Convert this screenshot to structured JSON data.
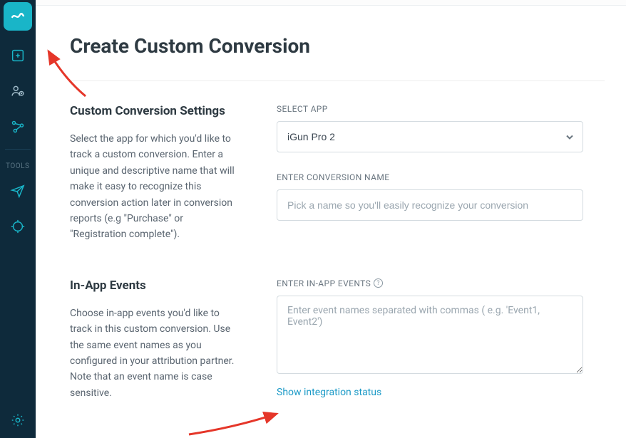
{
  "sidebar": {
    "tools_label": "TOOLS"
  },
  "page": {
    "title": "Create Custom Conversion"
  },
  "section_settings": {
    "heading": "Custom Conversion Settings",
    "description": "Select the app for which you'd like to track a custom conversion. Enter a unique and descriptive name that will make it easy to recognize this conversion action later in conversion reports (e.g \"Purchase\" or \"Registration complete\").",
    "select_app_label": "SELECT APP",
    "selected_app": "iGun Pro 2",
    "conversion_name_label": "ENTER CONVERSION NAME",
    "conversion_name_placeholder": "Pick a name so you'll easily recognize your conversion"
  },
  "section_events": {
    "heading": "In-App Events",
    "description": "Choose in-app events you'd like to track in this custom conversion. Use the same event names as you configured in your attribution partner. Note that an event name is case sensitive.",
    "events_label": "ENTER IN-APP EVENTS",
    "events_placeholder": "Enter event names separated with commas ( e.g. 'Event1, Event2')",
    "integration_link": "Show integration status"
  }
}
